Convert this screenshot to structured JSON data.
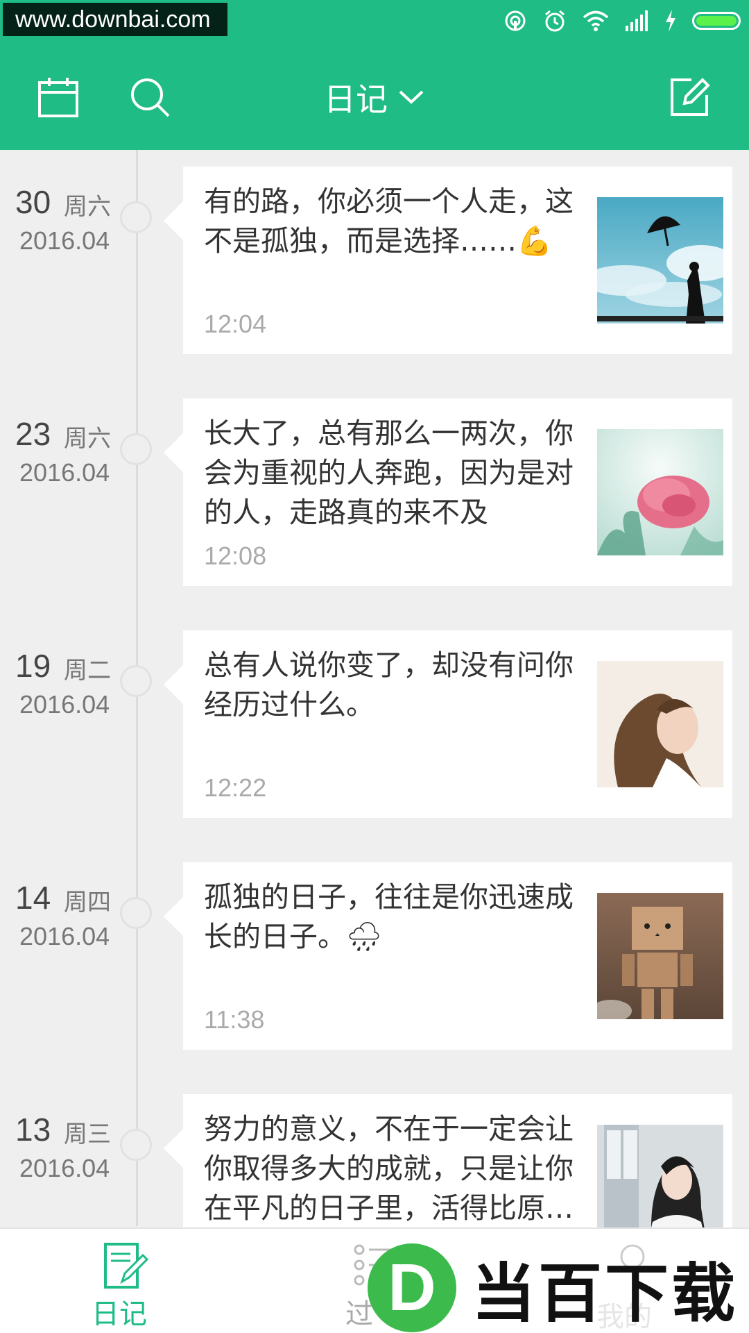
{
  "status_bar": {
    "watermark": "www.downbai.com",
    "icons": [
      "hotspot-icon",
      "alarm-icon",
      "wifi-icon",
      "signal-icon",
      "charging-icon",
      "battery-icon"
    ]
  },
  "toolbar": {
    "title": "日记",
    "icons": [
      "calendar-icon",
      "search-icon",
      "chevron-down-icon",
      "edit-icon"
    ]
  },
  "entries": [
    {
      "day": "30",
      "weekday": "周六",
      "year_month": "2016.04",
      "text": "有的路，你必须一个人走，这不是孤独，而是选择……💪",
      "time": "12:04",
      "thumb": "girl-with-umbrella"
    },
    {
      "day": "23",
      "weekday": "周六",
      "year_month": "2016.04",
      "text": "长大了，总有那么一两次，你会为重视的人奔跑，因为是对的人，走路真的来不及",
      "time": "12:08",
      "thumb": "pink-flower"
    },
    {
      "day": "19",
      "weekday": "周二",
      "year_month": "2016.04",
      "text": "总有人说你变了，却没有问你经历过什么。",
      "time": "12:22",
      "thumb": "woman-portrait"
    },
    {
      "day": "14",
      "weekday": "周四",
      "year_month": "2016.04",
      "text": "孤独的日子，往往是你迅速成长的日子。🌧",
      "time": "11:38",
      "thumb": "danbo-figure"
    },
    {
      "day": "13",
      "weekday": "周三",
      "year_month": "2016.04",
      "text": "努力的意义，不在于一定会让你取得多大的成就，只是让你在平凡的日子里，活得比原…",
      "time": "",
      "thumb": "girl-at-window"
    }
  ],
  "bottom_nav": {
    "items": [
      {
        "label": "日记",
        "icon": "notebook-icon",
        "active": true
      },
      {
        "label": "过",
        "icon": "list-icon",
        "active": false
      },
      {
        "label": "我的",
        "icon": "profile-icon",
        "active": false
      }
    ]
  },
  "logo": {
    "letter": "D",
    "text": "当百下载"
  },
  "colors": {
    "accent": "#1fbc86",
    "active_nav": "#1fbc86",
    "text": "#333333",
    "muted": "#aaaaaa"
  }
}
